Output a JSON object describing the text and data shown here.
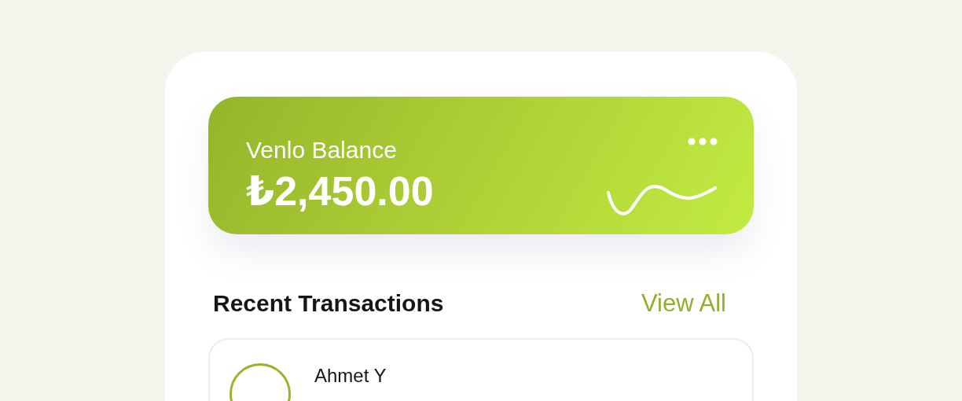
{
  "balance_card": {
    "label": "Venlo Balance",
    "amount": "₺2,450.00"
  },
  "transactions": {
    "title": "Recent Transactions",
    "view_all": "View All",
    "items": [
      {
        "name": "Ahmet Y"
      }
    ]
  }
}
